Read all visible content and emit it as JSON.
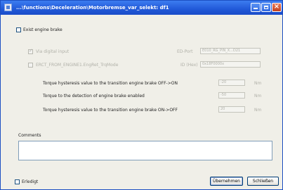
{
  "window": {
    "title": "...\\functions\\Deceleration\\Motorbremse_var_selekt: df1"
  },
  "exist_engine_brake": {
    "label": "Exist engine brake",
    "checked": false
  },
  "via_digital_input": {
    "label": "Via digital input",
    "checked": true
  },
  "ed_port": {
    "label": "ED-Port",
    "value": "E010_RG_PIN_X...D21"
  },
  "erct": {
    "label": "ERCT_FROM_ENGINE1.EngRet_TrqMode",
    "checked": false
  },
  "id_hex": {
    "label": "ID (Hex)",
    "value": "0x18F0000x"
  },
  "torque_rows": [
    {
      "label": "Torque hysteresis value to the transition engine brake  OFF->ON",
      "value": "-20",
      "unit": "Nm"
    },
    {
      "label": "Torque to the detection of engine brake enabled",
      "value": "-50",
      "unit": "Nm"
    },
    {
      "label": "Torque hysteresis value to the transition engine brake  ON->OFF",
      "value": "20",
      "unit": "Nm"
    }
  ],
  "comments": {
    "label": "Comments",
    "value": ""
  },
  "erledigt": {
    "label": "Erledigt",
    "checked": false
  },
  "buttons": {
    "apply": "Übernehmen",
    "close": "Schließen"
  }
}
